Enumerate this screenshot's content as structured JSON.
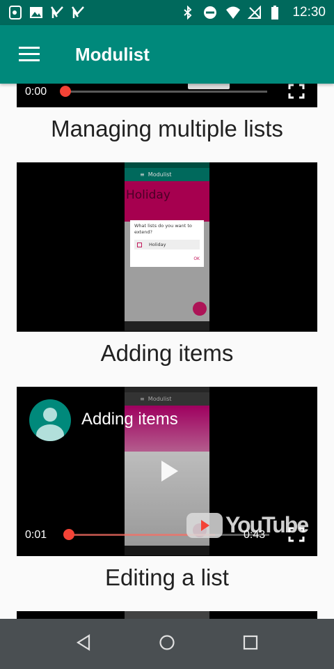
{
  "status_bar": {
    "time": "12:30",
    "left_icons": [
      "notification-icon",
      "image-icon",
      "check-flag-icon",
      "check-flag-icon"
    ],
    "right_icons": [
      "bluetooth-icon",
      "do-not-disturb-icon",
      "wifi-icon",
      "no-signal-icon",
      "battery-icon"
    ]
  },
  "app_bar": {
    "title": "Modulist",
    "menu_icon": "hamburger-menu-icon",
    "color": "#00897b"
  },
  "videos": [
    {
      "caption": "Managing multiple lists",
      "time_current": "0:00",
      "progress_fraction": 0.0
    },
    {
      "caption": "Adding items",
      "preview": {
        "app_title": "Modulist",
        "list_name": "Holiday",
        "dialog_title": "What lists do you want to extend?",
        "dialog_option": "Holiday",
        "dialog_button": "OK"
      }
    },
    {
      "caption": "Editing a list",
      "overlay_title": "Adding items",
      "preview_app_title": "Modulist",
      "time_current": "0:01",
      "time_total": "0:43",
      "progress_fraction": 0.023,
      "brand": "YouTube"
    }
  ],
  "nav_bar": {
    "buttons": [
      "back-icon",
      "home-icon",
      "recents-icon"
    ]
  }
}
